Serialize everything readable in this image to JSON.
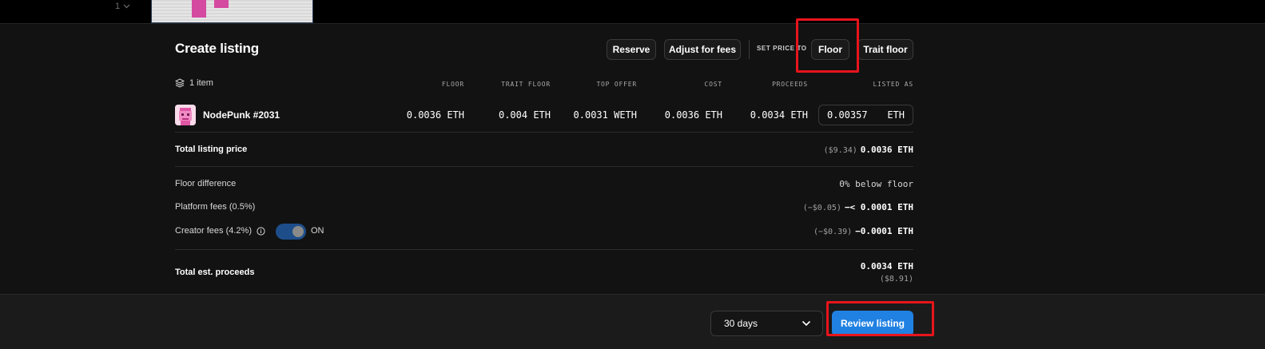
{
  "top": {
    "index": "1"
  },
  "listing": {
    "title": "Create listing",
    "buttons": {
      "reserve": "Reserve",
      "adjust_for_fees": "Adjust for fees",
      "floor": "Floor",
      "trait_floor": "Trait floor"
    },
    "set_price_to": "SET PRICE TO",
    "item_count": "1 item",
    "columns": [
      "FLOOR",
      "TRAIT FLOOR",
      "TOP OFFER",
      "COST",
      "PROCEEDS",
      "LISTED AS"
    ],
    "item": {
      "name": "NodePunk #2031",
      "floor": "0.0036 ETH",
      "trait_floor": "0.004 ETH",
      "top_offer": "0.0031 WETH",
      "cost": "0.0036 ETH",
      "proceeds": "0.0034 ETH",
      "listed_value": "0.00357",
      "listed_unit": "ETH"
    },
    "total_listing_price": {
      "label": "Total listing price",
      "usd": "($9.34)",
      "eth": "0.0036 ETH"
    },
    "floor_difference": {
      "label": "Floor difference",
      "value": "0% below floor"
    },
    "platform_fees": {
      "label": "Platform fees (0.5%)",
      "usd": "(−$0.05)",
      "eth": "−< 0.0001 ETH"
    },
    "creator_fees": {
      "label": "Creator fees (4.2%)",
      "toggle": "ON",
      "usd": "(−$0.39)",
      "eth": "−0.0001 ETH"
    },
    "total_proceeds": {
      "label": "Total est. proceeds",
      "eth": "0.0034 ETH",
      "usd": "($8.91)"
    }
  },
  "footer": {
    "duration": "30 days",
    "review_button": "Review listing"
  },
  "colors": {
    "accent": "#2081e2",
    "highlight": "#e8141c",
    "background": "#121212"
  }
}
